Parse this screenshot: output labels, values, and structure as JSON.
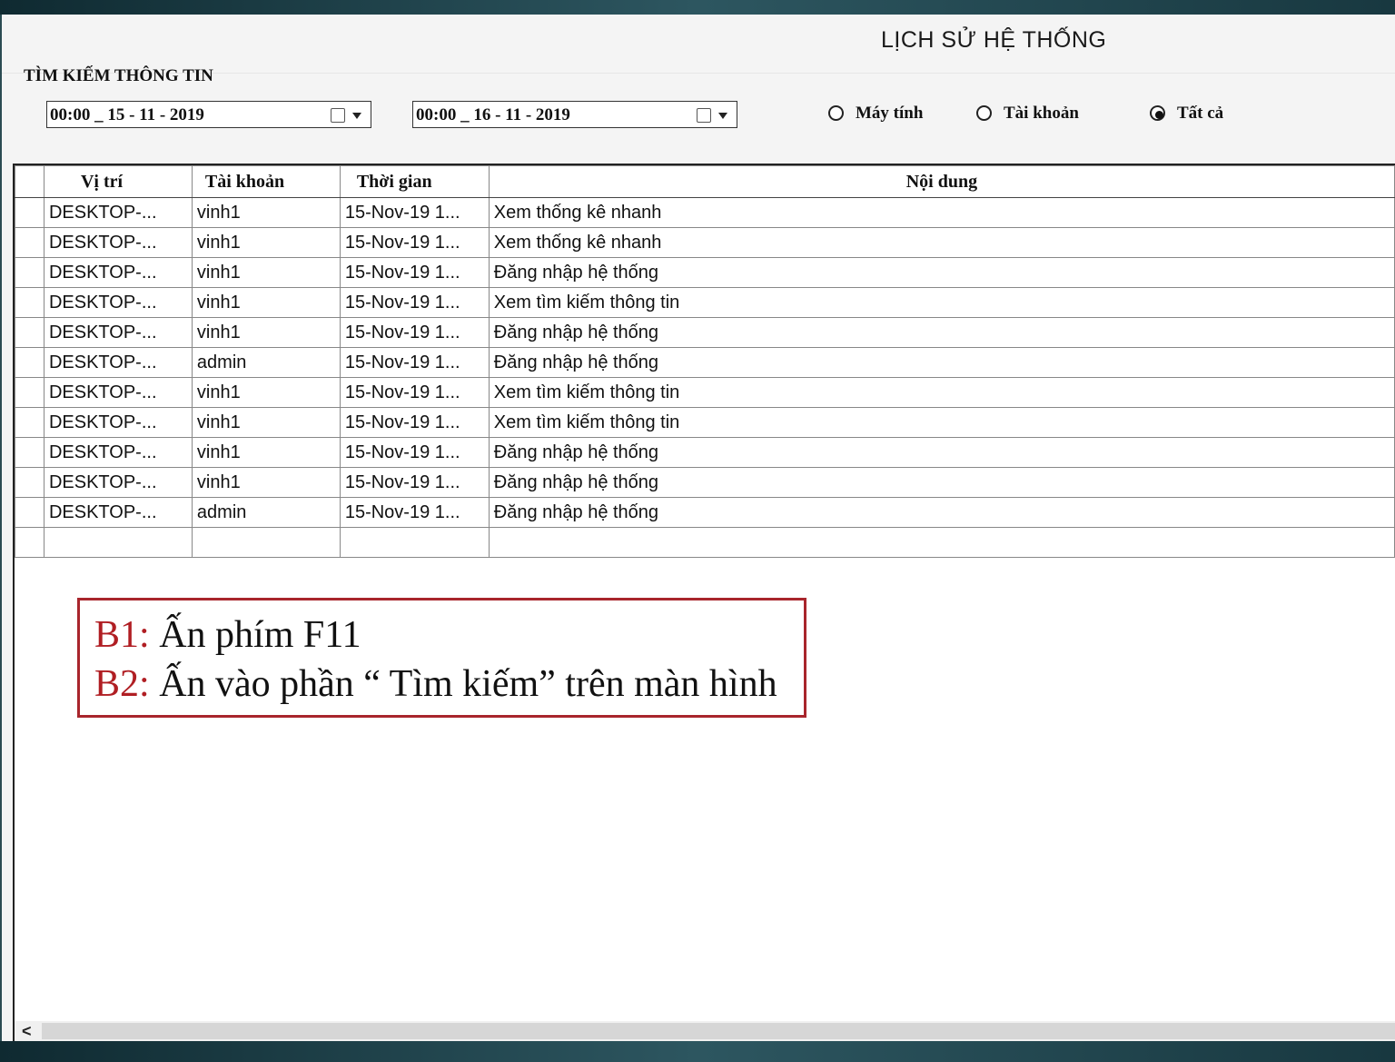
{
  "title": "LỊCH SỬ HỆ THỐNG",
  "search": {
    "label": "TÌM KIẾM THÔNG TIN",
    "from_date": "00:00 _ 15 - 11 - 2019",
    "to_date": "00:00 _ 16 - 11 - 2019"
  },
  "filters": [
    {
      "label": "Máy tính",
      "selected": false
    },
    {
      "label": "Tài khoản",
      "selected": false
    },
    {
      "label": "Tất cả",
      "selected": true
    }
  ],
  "table": {
    "columns": [
      "Vị trí",
      "Tài khoản",
      "Thời gian",
      "Nội dung"
    ],
    "rows": [
      [
        "DESKTOP-...",
        "vinh1",
        "15-Nov-19 1...",
        "Xem thống kê nhanh"
      ],
      [
        "DESKTOP-...",
        "vinh1",
        "15-Nov-19 1...",
        "Xem thống kê nhanh"
      ],
      [
        "DESKTOP-...",
        "vinh1",
        "15-Nov-19 1...",
        "Đăng nhập hệ thống"
      ],
      [
        "DESKTOP-...",
        "vinh1",
        "15-Nov-19 1...",
        "Xem tìm kiếm thông tin"
      ],
      [
        "DESKTOP-...",
        "vinh1",
        "15-Nov-19 1...",
        "Đăng nhập hệ thống"
      ],
      [
        "DESKTOP-...",
        "admin",
        "15-Nov-19 1...",
        "Đăng nhập hệ thống"
      ],
      [
        "DESKTOP-...",
        "vinh1",
        "15-Nov-19 1...",
        "Xem tìm kiếm thông tin"
      ],
      [
        "DESKTOP-...",
        "vinh1",
        "15-Nov-19 1...",
        "Xem tìm kiếm thông tin"
      ],
      [
        "DESKTOP-...",
        "vinh1",
        "15-Nov-19 1...",
        "Đăng nhập hệ thống"
      ],
      [
        "DESKTOP-...",
        "vinh1",
        "15-Nov-19 1...",
        "Đăng nhập hệ thống"
      ],
      [
        "DESKTOP-...",
        "admin",
        "15-Nov-19 1...",
        "Đăng nhập hệ thống"
      ]
    ]
  },
  "scrollbar": {
    "left_arrow": "<"
  },
  "note": {
    "steps": [
      {
        "step": "B1:",
        "text": " Ấn phím F11"
      },
      {
        "step": "B2:",
        "text": " Ấn vào phần “ Tìm kiếm” trên màn hình"
      }
    ]
  },
  "colors": {
    "note_border": "#a8252c",
    "note_step": "#b01e23"
  }
}
